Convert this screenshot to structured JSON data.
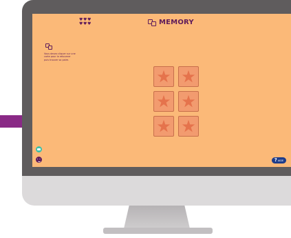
{
  "game": {
    "title": "MEMORY",
    "lives": [
      "♥",
      "♥",
      "♥",
      "♥",
      "♥",
      "♥"
    ],
    "instructions": "Vous devez cliquer sur une carte pour la retourner puis trouver sa paire.",
    "aide_label": "AIDE",
    "aide_symbol": "?"
  },
  "board": {
    "rows": 3,
    "columns": 2,
    "cards": [
      {
        "state": "face-down",
        "icon": "star-icon"
      },
      {
        "state": "face-down",
        "icon": "star-icon"
      },
      {
        "state": "face-down",
        "icon": "star-icon"
      },
      {
        "state": "face-down",
        "icon": "star-icon"
      },
      {
        "state": "face-down",
        "icon": "star-icon"
      },
      {
        "state": "face-down",
        "icon": "star-icon"
      }
    ]
  },
  "colors": {
    "background": "#fbb978",
    "accent": "#5e1b5a",
    "card": "#f29b6f",
    "star": "#e5734c",
    "help_button": "#1e3c8a",
    "chat_button": "#3fc0a8"
  }
}
